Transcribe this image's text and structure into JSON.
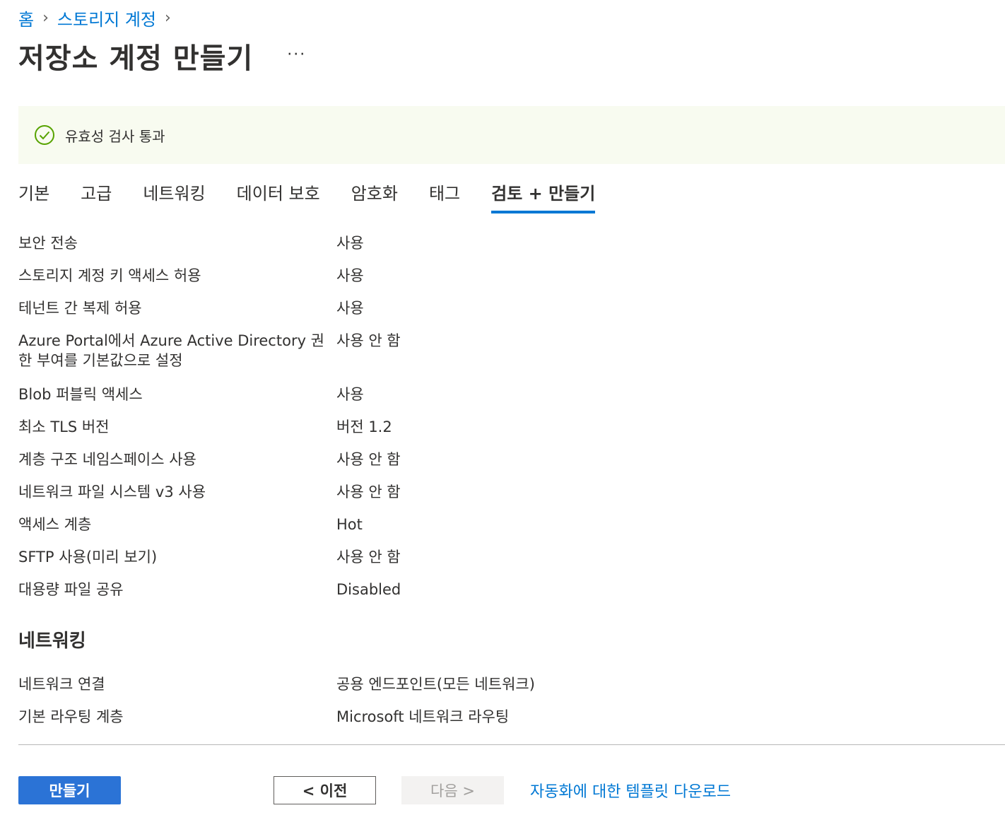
{
  "breadcrumb": {
    "home": "홈",
    "storage_accounts": "스토리지 계정"
  },
  "page": {
    "title": "저장소 계정 만들기",
    "more": "···"
  },
  "validation": {
    "message": "유효성 검사 통과"
  },
  "tabs": [
    {
      "label": "기본"
    },
    {
      "label": "고급"
    },
    {
      "label": "네트워킹"
    },
    {
      "label": "데이터 보호"
    },
    {
      "label": "암호화"
    },
    {
      "label": "태그"
    },
    {
      "label": "검토 + 만들기"
    }
  ],
  "settings": [
    {
      "label": "보안 전송",
      "value": "사용"
    },
    {
      "label": "스토리지 계정 키 액세스 허용",
      "value": "사용"
    },
    {
      "label": "테넌트 간 복제 허용",
      "value": "사용"
    },
    {
      "label": "Azure Portal에서 Azure Active Directory 권한 부여를 기본값으로 설정",
      "value": "사용 안 함"
    },
    {
      "label": "Blob 퍼블릭 액세스",
      "value": "사용"
    },
    {
      "label": "최소 TLS 버전",
      "value": "버전 1.2"
    },
    {
      "label": "계층 구조 네임스페이스 사용",
      "value": "사용 안 함"
    },
    {
      "label": "네트워크 파일 시스템 v3 사용",
      "value": "사용 안 함"
    },
    {
      "label": "액세스 계층",
      "value": "Hot"
    },
    {
      "label": "SFTP 사용(미리 보기)",
      "value": "사용 안 함"
    },
    {
      "label": "대용량 파일 공유",
      "value": "Disabled"
    }
  ],
  "networking": {
    "heading": "네트워킹",
    "rows": [
      {
        "label": "네트워크 연결",
        "value": "공용 엔드포인트(모든 네트워크)"
      },
      {
        "label": "기본 라우팅 계층",
        "value": "Microsoft 네트워크 라우팅"
      }
    ]
  },
  "footer": {
    "create": "만들기",
    "previous": "< 이전",
    "next": "다음 >",
    "download_template": "자동화에 대한 템플릿 다운로드"
  },
  "colors": {
    "accent": "#0078d4",
    "primary_button": "#2b73d6",
    "success": "#57a300",
    "banner_bg": "#f8fbf0"
  }
}
